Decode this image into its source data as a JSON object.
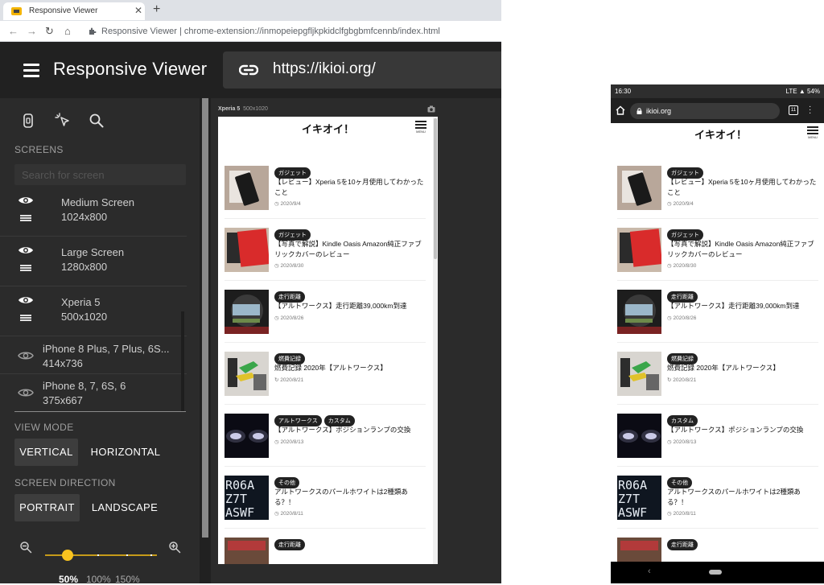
{
  "browser": {
    "tab_title": "Responsive Viewer",
    "new_tab": "+",
    "tab_close": "✕",
    "address_text": "Responsive Viewer  |  chrome-extension://inmopeiepgfljkpkidclfgbgbmfcennb/index.html"
  },
  "app": {
    "title": "Responsive Viewer",
    "url": "https://ikioi.org/"
  },
  "sidebar": {
    "screens_header": "SCREENS",
    "search_placeholder": "Search for screen",
    "screens": [
      {
        "name": "Medium Screen",
        "size": "1024x800",
        "visible": true
      },
      {
        "name": "Large Screen",
        "size": "1280x800",
        "visible": true
      },
      {
        "name": "Xperia 5",
        "size": "500x1020",
        "visible": true
      },
      {
        "name": "iPhone 8 Plus, 7 Plus, 6S...",
        "size": "414x736",
        "visible": false
      },
      {
        "name": "iPhone 8, 7, 6S, 6",
        "size": "375x667",
        "visible": false
      }
    ],
    "view_mode_header": "VIEW MODE",
    "view_mode_vertical": "VERTICAL",
    "view_mode_horizontal": "HORIZONTAL",
    "direction_header": "SCREEN DIRECTION",
    "direction_portrait": "PORTRAIT",
    "direction_landscape": "LANDSCAPE",
    "zoom": {
      "value": 50,
      "labels": [
        "50%",
        "100%",
        "150%"
      ]
    }
  },
  "preview": {
    "device_name": "Xperia 5",
    "device_size": "500x1020",
    "site_title": "イキオイ！",
    "menu_label": "MENU"
  },
  "posts": [
    {
      "tags": [
        "ガジェット"
      ],
      "title": "【レビュー】Xperia 5を10ヶ月使用してわかったこと",
      "date": "2020/9/4"
    },
    {
      "tags": [
        "ガジェット"
      ],
      "title": "【写真で解説】Kindle Oasis Amazon純正ファブリックカバーのレビュー",
      "date": "2020/8/30"
    },
    {
      "tags": [
        "走行距離"
      ],
      "title": "【アルトワークス】走行距離39,000km到達",
      "date": "2020/8/26"
    },
    {
      "tags": [
        "燃費記録"
      ],
      "title": "燃費記録 2020年【アルトワークス】",
      "date": "2020/8/21"
    },
    {
      "tags": [
        "アルトワークス",
        "カスタム"
      ],
      "title": "【アルトワークス】ポジションランプの交換",
      "date": "2020/8/13"
    },
    {
      "tags": [
        "その他"
      ],
      "title": "アルトワークスのパールホワイトは2種類ある？！",
      "date": "2020/8/11"
    },
    {
      "tags": [
        "走行距離"
      ],
      "title": "",
      "date": ""
    }
  ],
  "phone": {
    "time": "16:30",
    "battery": "LTE ▲ 54%",
    "address": "ikioi.org",
    "tabs_count": "11",
    "second_post_tags": [
      "カスタム"
    ]
  },
  "colors": {
    "app_bar": "#212121",
    "sidebar": "#2b2b2b",
    "slider": "#f9c31f"
  }
}
